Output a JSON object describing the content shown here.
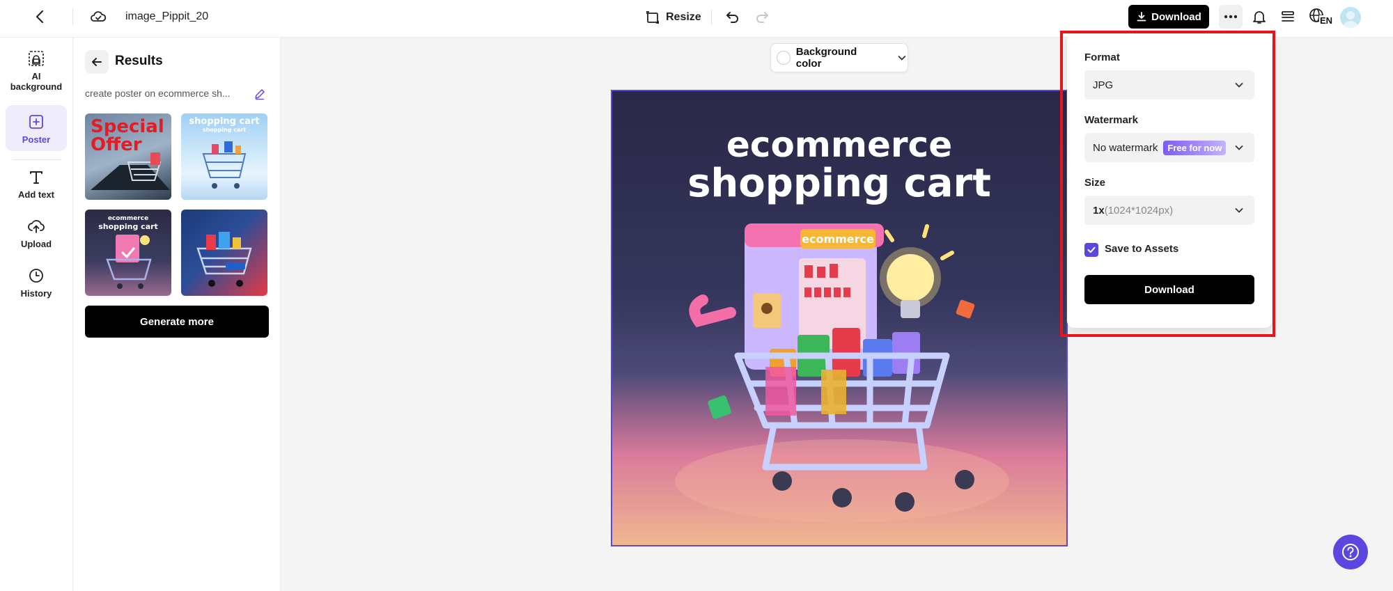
{
  "topbar": {
    "project_name": "image_Pippit_20",
    "resize_label": "Resize",
    "download_label": "Download",
    "lang_label": "EN"
  },
  "rail": {
    "items": [
      {
        "label": "AI background",
        "icon": "ai-background-icon"
      },
      {
        "label": "Poster",
        "icon": "poster-icon",
        "active": true
      },
      {
        "label": "Add text",
        "icon": "text-icon"
      },
      {
        "label": "Upload",
        "icon": "upload-icon"
      },
      {
        "label": "History",
        "icon": "history-icon"
      }
    ]
  },
  "results": {
    "title": "Results",
    "prompt": "create poster on ecommerce sh...",
    "thumbnails": [
      {
        "text_line1": "Special",
        "text_line2": "Offer"
      },
      {
        "text_line1": "shopping cart",
        "text_line2": "shopping cart"
      },
      {
        "text_line1": "ecommerce",
        "text_line2": "shopping cart",
        "selected": true
      },
      {
        "text_line1": "",
        "text_line2": ""
      }
    ],
    "generate_more": "Generate more"
  },
  "canvas": {
    "background_color_label": "Background color",
    "poster": {
      "line1": "ecommerce",
      "line2": "shopping cart",
      "sign": "ecommerce"
    }
  },
  "download_panel": {
    "format_label": "Format",
    "format_value": "JPG",
    "watermark_label": "Watermark",
    "watermark_value": "No watermark",
    "watermark_badge": "Free for now",
    "size_label": "Size",
    "size_scale": "1x",
    "size_dims": "(1024*1024px)",
    "save_to_assets_label": "Save to Assets",
    "save_to_assets_checked": true,
    "download_button": "Download"
  },
  "colors": {
    "accent": "#5b47e0",
    "highlight": "#e8141c"
  }
}
